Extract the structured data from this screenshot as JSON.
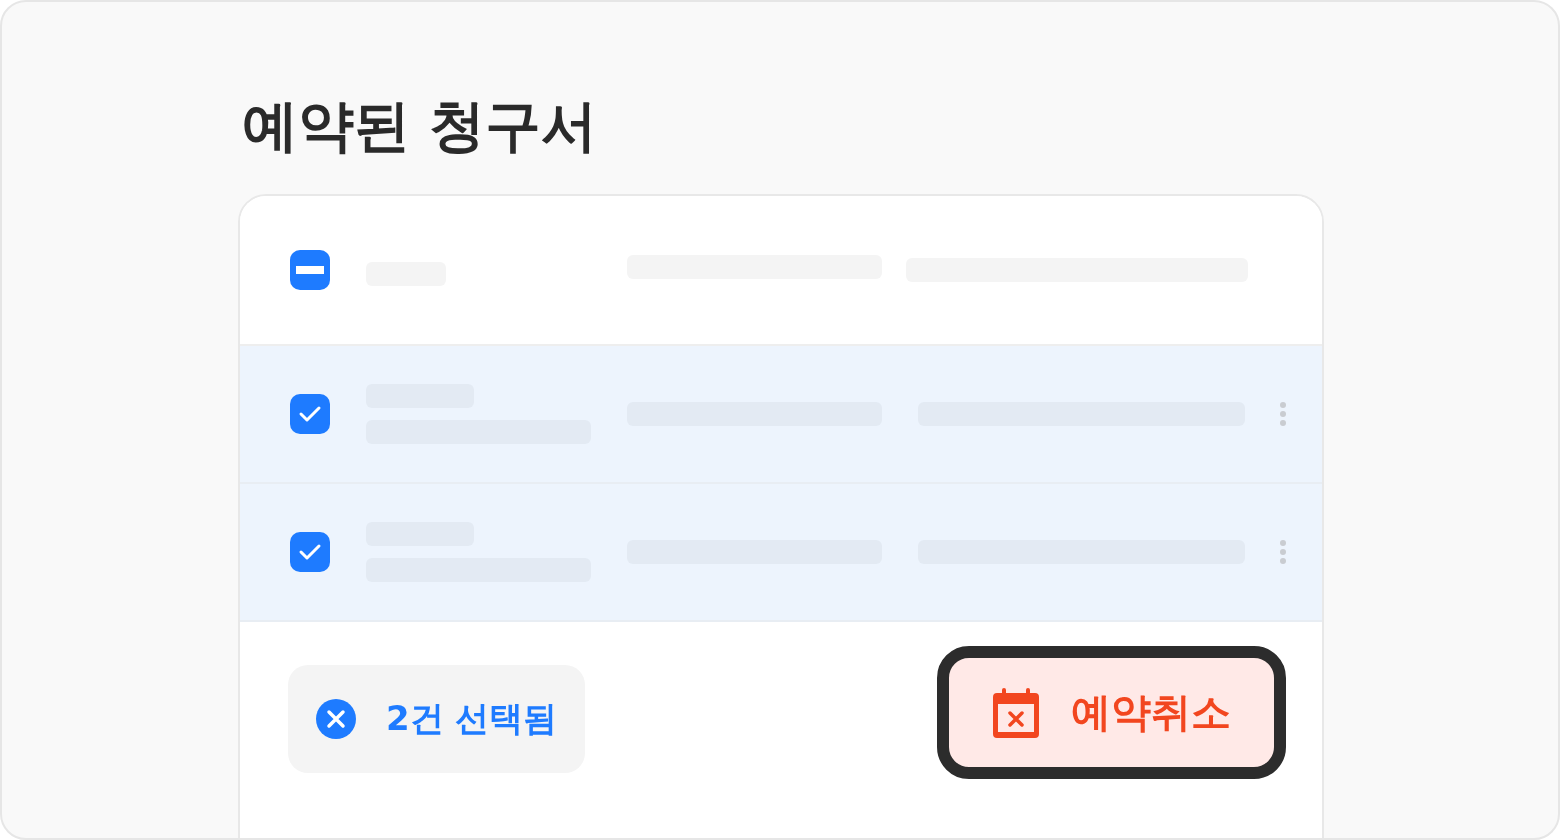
{
  "title": "예약된 청구서",
  "header_row": {
    "indeterminate": true
  },
  "rows": [
    {
      "selected": true
    },
    {
      "selected": true
    }
  ],
  "selection_chip": {
    "label": "2건 선택됨"
  },
  "cancel_button": {
    "label": "예약취소",
    "focused": true
  }
}
